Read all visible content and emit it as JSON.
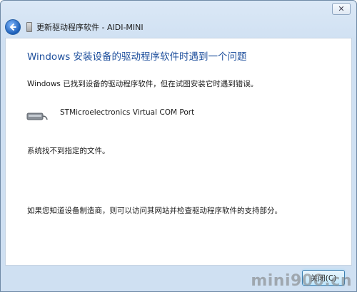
{
  "window": {
    "close_glyph": "✕",
    "title": "更新驱动程序软件 - AIDI-MINI"
  },
  "main": {
    "heading": "Windows 安装设备的驱动程序软件时遇到一个问题",
    "message": "Windows 已找到设备的驱动程序软件，但在试图安装它时遇到错误。",
    "device_name": "STMicroelectronics Virtual COM Port",
    "error_text": "系统找不到指定的文件。",
    "support_text": "如果您知道设备制造商，则可以访问其网站并检查驱动程序软件的支持部分。"
  },
  "footer": {
    "close_label": "关闭(C)"
  },
  "watermark": "mini900.cn",
  "colors": {
    "heading": "#1e4f9c",
    "frame": "#cfe0f2"
  }
}
